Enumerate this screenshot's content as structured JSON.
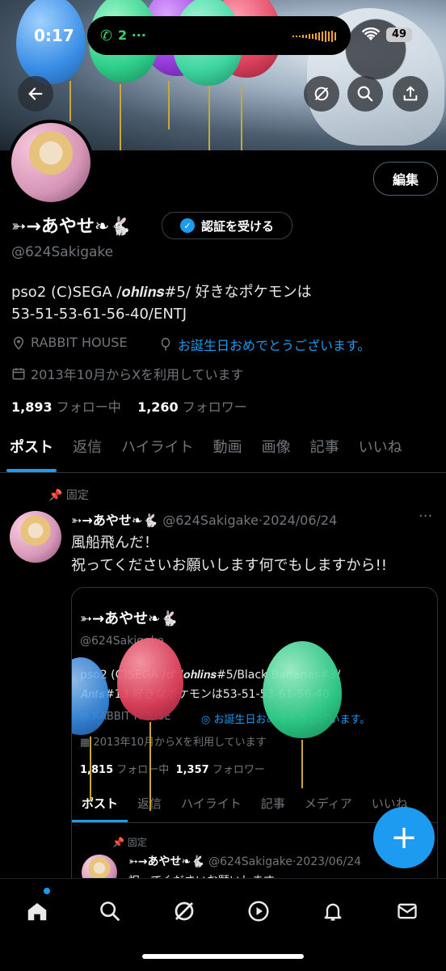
{
  "status_bar": {
    "time": "0:17",
    "call_count": "2 ···",
    "battery": "49"
  },
  "profile": {
    "display_name": "➳→あやせ❧🐇",
    "verify_label": "認証を受ける",
    "edit_label": "編集",
    "handle": "@624Sakigake",
    "bio_line1": "pso2 (C)SEGA /𝒐𝒉𝒍𝒊𝒏𝒔#5/ 好きなポケモンは",
    "bio_line2": "53-51-53-61-56-40/ENTJ",
    "location": "RABBIT HOUSE",
    "birthday": "お誕生日おめでとうございます。",
    "joined": "2013年10月からXを利用しています",
    "following_count": "1,893",
    "following_label": "フォロー中",
    "followers_count": "1,260",
    "followers_label": "フォロワー"
  },
  "tabs": [
    "ポスト",
    "返信",
    "ハイライト",
    "動画",
    "画像",
    "記事",
    "いいね"
  ],
  "tweet": {
    "pinned": "固定",
    "name": "➳→あやせ❧🐇",
    "handle_date": "@624Sakigake·2024/06/24",
    "text_line1": "風船飛んだ！",
    "text_line2": "祝ってくださいお願いします何でもしますから!!",
    "more": "···"
  },
  "embedded": {
    "name": "➳→あやせ❧🐇",
    "handle": "@624Sakigake",
    "bio_line1": "pso2 (C)SEGA /♂ /𝒐𝒉𝒍𝒊𝒏𝒔#5/Black Bananas#3/",
    "bio_line2": "𝑨𝒏𝒕𝒔#13 好きなポケモンは53-51-53-61-56-40",
    "location": "RABBIT HOUSE",
    "birthday": "お誕生日おめでとうございます。",
    "joined": "2013年10月からXを利用しています",
    "following_count": "1,815",
    "following_label": "フォロー中",
    "followers_count": "1,357",
    "followers_label": "フォロワー",
    "tabs": [
      "ポスト",
      "返信",
      "ハイライト",
      "記事",
      "メディア",
      "いいね"
    ],
    "pinned": "固定",
    "post_handle_date": "@624Sakigake·2023/06/24",
    "post_text": "祝ってくださいお願いします"
  },
  "fab_label": "+",
  "colors": {
    "accent": "#1d9bf0",
    "background": "#000000",
    "muted": "#71767b"
  },
  "icons": [
    "back-arrow-icon",
    "grok-icon",
    "search-icon",
    "share-icon",
    "location-icon",
    "balloon-icon",
    "calendar-icon",
    "pin-icon",
    "home-icon",
    "explore-icon",
    "video-icon",
    "notifications-icon",
    "messages-icon"
  ]
}
